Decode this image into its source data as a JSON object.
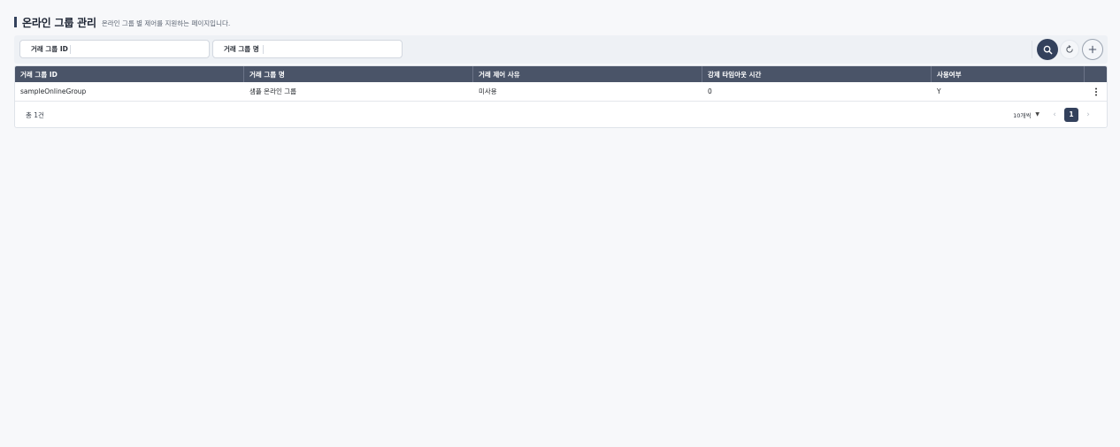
{
  "header": {
    "title": "온라인 그룹 관리",
    "description": "온라인 그룹 별 제어를 지원하는 페이지입니다."
  },
  "search": {
    "fields": [
      {
        "label": "거래 그룹 ID",
        "value": "",
        "placeholder": ""
      },
      {
        "label": "거래 그룹 명",
        "value": "",
        "placeholder": ""
      }
    ],
    "buttons": {
      "search": "search-icon",
      "reset": "reset-icon",
      "add": "plus-icon"
    }
  },
  "table": {
    "columns": [
      "거래 그룹 ID",
      "거래 그룹 명",
      "거래 제어 사유",
      "강제 타임아웃 시간",
      "사용여부",
      ""
    ],
    "rows": [
      [
        "sampleOnlineGroup",
        "샘플 온라인 그룹",
        "미사용",
        "0",
        "Y",
        "more-vertical-icon"
      ]
    ]
  },
  "footer": {
    "total": "총 1건",
    "page_size": "10개씩",
    "current_page": "1"
  },
  "colors": {
    "accent": "#33415c",
    "table_header": "#4a5468",
    "background": "#f7f8fa"
  }
}
